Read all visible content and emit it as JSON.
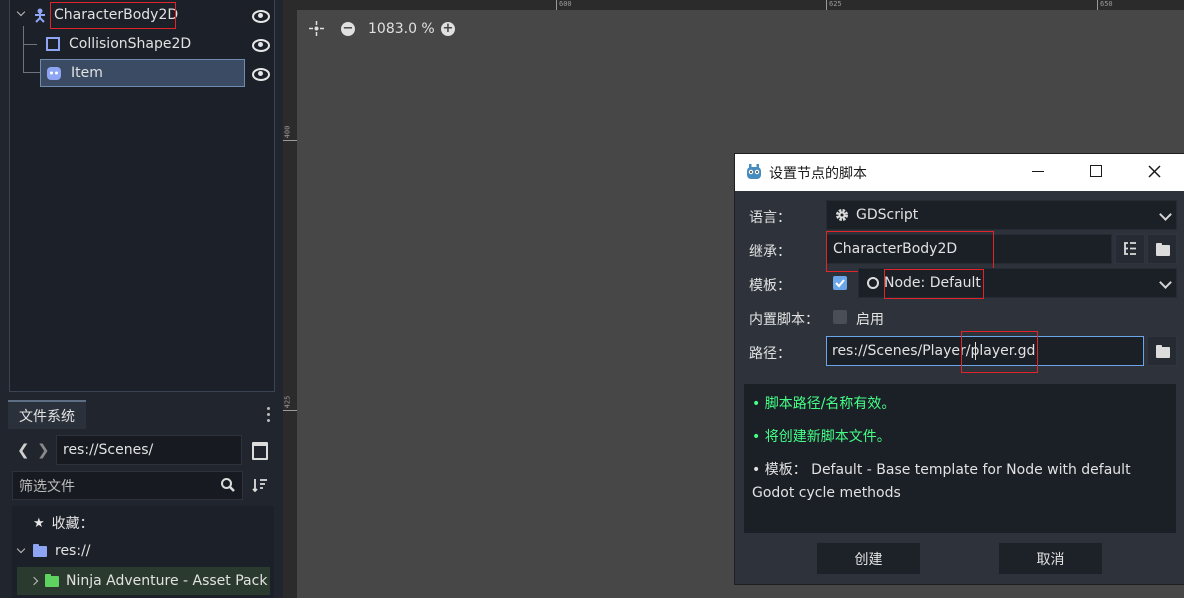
{
  "scene_tree": {
    "items": [
      {
        "label": "CharacterBody2D",
        "icon": "character-body-icon"
      },
      {
        "label": "CollisionShape2D",
        "icon": "collision-shape-icon"
      },
      {
        "label": "Item",
        "icon": "sprite-icon"
      }
    ]
  },
  "filesystem": {
    "tab_label": "文件系统",
    "path_value": "res://Scenes/",
    "filter_placeholder": "筛选文件",
    "favorites_label": "收藏：",
    "root_label": "res://",
    "folder_label": "Ninja Adventure - Asset Pack"
  },
  "viewport": {
    "zoom_text": "1083.0 %",
    "ruler_h": [
      "600",
      "625",
      "650"
    ],
    "ruler_v": [
      "400",
      "425"
    ]
  },
  "dialog": {
    "title": "设置节点的脚本",
    "language_label": "语言：",
    "language_value": "GDScript",
    "inherits_label": "继承：",
    "inherits_value": "CharacterBody2D",
    "template_label": "模板：",
    "template_value": "Node: Default",
    "builtin_label": "内置脚本：",
    "builtin_option": "启用",
    "path_label": "路径：",
    "path_value": "res://Scenes/Player/player.gd",
    "messages": {
      "valid": "• 脚本路径/名称有效。",
      "create": "• 将创建新脚本文件。",
      "template": "• 模板： Default - Base template for Node with default Godot cycle methods"
    },
    "create_button": "创建",
    "cancel_button": "取消"
  },
  "colors": {
    "highlight": "#e0262a",
    "success_text": "#44ff88",
    "selected_row": "#3a4b63",
    "input_focus": "#6aa7ea"
  }
}
